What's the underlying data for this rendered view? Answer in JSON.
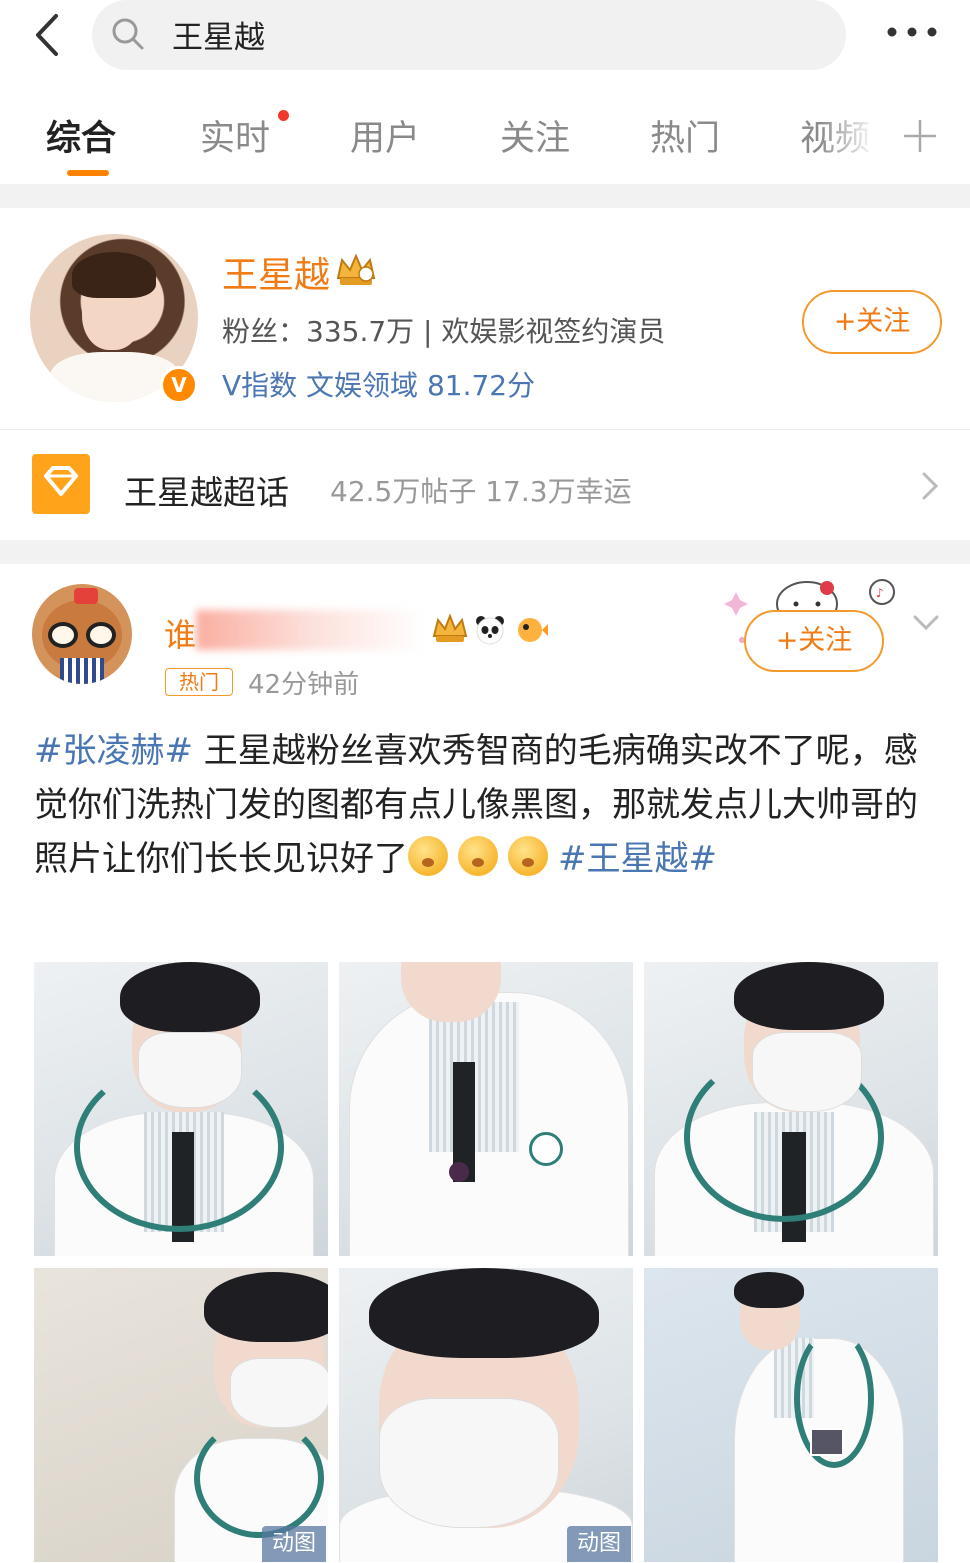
{
  "search": {
    "query": "王星越"
  },
  "tabs": [
    {
      "label": "综合"
    },
    {
      "label": "实时"
    },
    {
      "label": "用户"
    },
    {
      "label": "关注"
    },
    {
      "label": "热门"
    },
    {
      "label": "视频"
    }
  ],
  "profile": {
    "name": "王星越",
    "fans": "粉丝：335.7万 | 欢娱影视签约演员",
    "vindex": "V指数 文娱领域 81.72分",
    "follow_label": "+关注",
    "verified_mark": "V"
  },
  "supertopic": {
    "name": "王星越超话",
    "stats": "42.5万帖子  17.3万幸运"
  },
  "post": {
    "author": "谁",
    "hot_tag": "热门",
    "time": "42分钟前",
    "follow_label": "+关注",
    "text": {
      "tag1": "#张凌赫#",
      "body": " 王星越粉丝喜欢秀智商的毛病确实改不了呢，感觉你们洗热门发的图都有点儿像黑图，那就发点儿大帅哥的照片让你们长长见识好了",
      "tag2": "#王星越#"
    },
    "gif_label": "动图"
  },
  "icons": {
    "back": "chevron-left-icon",
    "search": "search-icon",
    "more": "more-dots-icon",
    "add_tab": "plus-icon",
    "supertopic": "supertopic-diamond-icon",
    "open": "chevron-right-icon",
    "post_menu": "chevron-down-icon"
  },
  "colors": {
    "accent": "#ff8200",
    "name_orange": "#f07b14",
    "link_blue": "#4a76b3",
    "live_dot": "#f0392b"
  }
}
